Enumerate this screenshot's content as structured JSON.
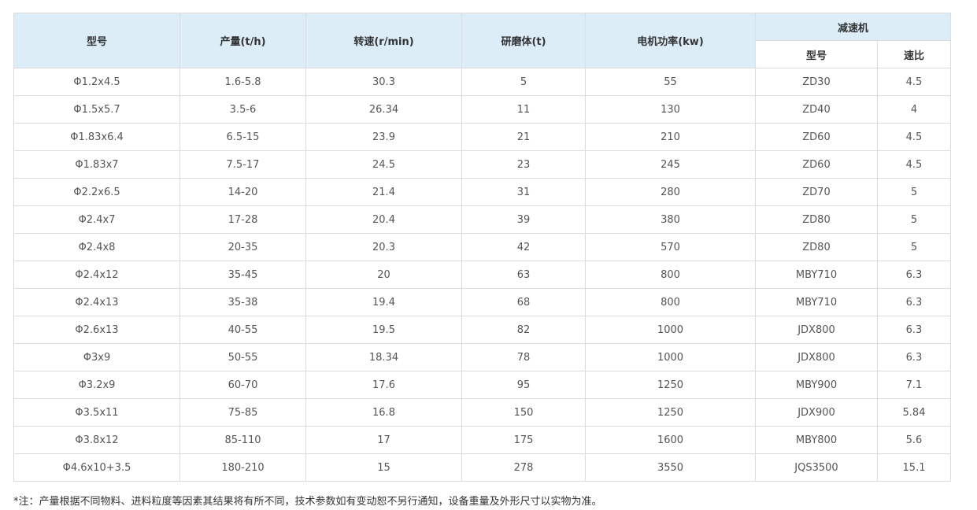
{
  "table": {
    "headers": {
      "model": "型号",
      "capacity": "产量(t/h)",
      "speed": "转速(r/min)",
      "media": "研磨体(t)",
      "motor_power": "电机功率(kw)",
      "reducer": "减速机",
      "reducer_model": "型号",
      "reducer_ratio": "速比"
    },
    "rows": [
      [
        "Φ1.2x4.5",
        "1.6-5.8",
        "30.3",
        "5",
        "55",
        "ZD30",
        "4.5"
      ],
      [
        "Φ1.5x5.7",
        "3.5-6",
        "26.34",
        "11",
        "130",
        "ZD40",
        "4"
      ],
      [
        "Φ1.83x6.4",
        "6.5-15",
        "23.9",
        "21",
        "210",
        "ZD60",
        "4.5"
      ],
      [
        "Φ1.83x7",
        "7.5-17",
        "24.5",
        "23",
        "245",
        "ZD60",
        "4.5"
      ],
      [
        "Φ2.2x6.5",
        "14-20",
        "21.4",
        "31",
        "280",
        "ZD70",
        "5"
      ],
      [
        "Φ2.4x7",
        "17-28",
        "20.4",
        "39",
        "380",
        "ZD80",
        "5"
      ],
      [
        "Φ2.4x8",
        "20-35",
        "20.3",
        "42",
        "570",
        "ZD80",
        "5"
      ],
      [
        "Φ2.4x12",
        "35-45",
        "20",
        "63",
        "800",
        "MBY710",
        "6.3"
      ],
      [
        "Φ2.4x13",
        "35-38",
        "19.4",
        "68",
        "800",
        "MBY710",
        "6.3"
      ],
      [
        "Φ2.6x13",
        "40-55",
        "19.5",
        "82",
        "1000",
        "JDX800",
        "6.3"
      ],
      [
        "Φ3x9",
        "50-55",
        "18.34",
        "78",
        "1000",
        "JDX800",
        "6.3"
      ],
      [
        "Φ3.2x9",
        "60-70",
        "17.6",
        "95",
        "1250",
        "MBY900",
        "7.1"
      ],
      [
        "Φ3.5x11",
        "75-85",
        "16.8",
        "150",
        "1250",
        "JDX900",
        "5.84"
      ],
      [
        "Φ3.8x12",
        "85-110",
        "17",
        "175",
        "1600",
        "MBY800",
        "5.6"
      ],
      [
        "Φ4.6x10+3.5",
        "180-210",
        "15",
        "278",
        "3550",
        "JQS3500",
        "15.1"
      ]
    ]
  },
  "footnote": "*注：产量根据不同物料、进料粒度等因素其结果将有所不同，技术参数如有变动恕不另行通知，设备重量及外形尺寸以实物为准。"
}
